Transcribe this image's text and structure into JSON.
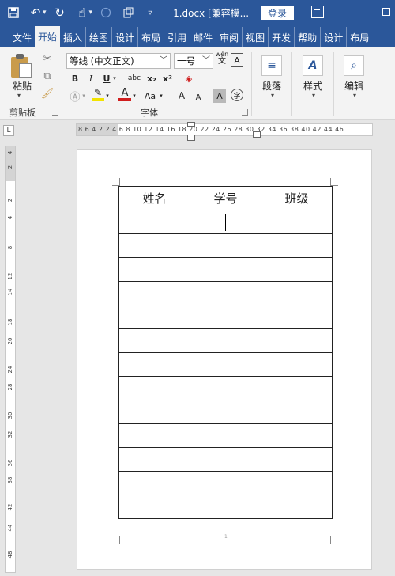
{
  "titlebar": {
    "doc_title": "1.docx [兼容模...",
    "login_label": "登录"
  },
  "tabs": [
    {
      "label": "文件"
    },
    {
      "label": "开始"
    },
    {
      "label": "插入"
    },
    {
      "label": "绘图"
    },
    {
      "label": "设计"
    },
    {
      "label": "布局"
    },
    {
      "label": "引用"
    },
    {
      "label": "邮件"
    },
    {
      "label": "审阅"
    },
    {
      "label": "视图"
    },
    {
      "label": "开发"
    },
    {
      "label": "帮助"
    },
    {
      "label": "设计"
    },
    {
      "label": "布局"
    }
  ],
  "ribbon": {
    "paste_label": "粘贴",
    "clipboard_label": "剪贴板",
    "font_name": "等线 (中文正文)",
    "font_size": "一号",
    "font_group_label": "字体",
    "bold": "B",
    "italic": "I",
    "underline": "U",
    "strike": "abc",
    "subscript": "x₂",
    "superscript": "x²",
    "case_label": "Aa",
    "grow_font": "A",
    "shrink_font": "A",
    "char_shade": "A",
    "enclose": "字",
    "pinyin": "wén",
    "pinyin_char": "文",
    "char_border": "A",
    "paragraph_label": "段落",
    "styles_label": "样式",
    "editing_label": "编辑"
  },
  "ruler": {
    "tab_selector": "L",
    "horizontal_text": "8 6 4 2       2 4 6 8 10 12 14 16 18 20 22 24 26 28 30 32 34 36 38 40 42 44 46",
    "vertical_ticks": [
      "4",
      "2",
      "2",
      "4",
      "8",
      "12",
      "14",
      "18",
      "20",
      "24",
      "28",
      "30",
      "32",
      "36",
      "38",
      "42",
      "44",
      "48"
    ]
  },
  "table": {
    "headers": [
      "姓名",
      "学号",
      "班级"
    ],
    "empty_rows": 13
  },
  "page": {
    "footer_mark": "1"
  },
  "colors": {
    "accent": "#2b579a",
    "ribbon_bg": "#f3f3f3",
    "workspace_bg": "#e6e6e6",
    "highlight_yellow": "#f2e300",
    "font_red": "#d01d1d"
  }
}
